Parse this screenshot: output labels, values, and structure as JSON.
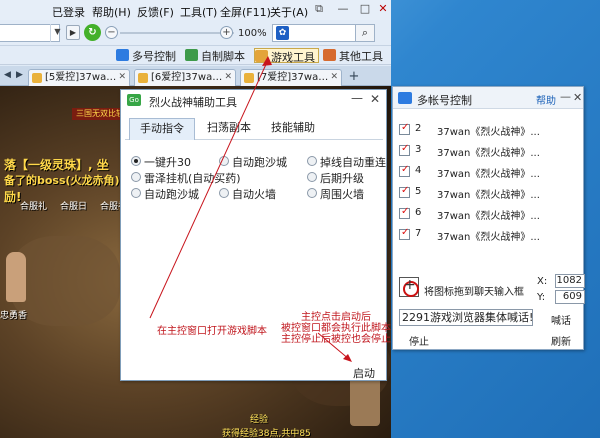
{
  "menu": {
    "login": "已登录",
    "help": "帮助(H)",
    "feedback": "反馈(F)",
    "tools": "工具(T)",
    "fullscreen": "全屏(F11)",
    "about": "关于(A)"
  },
  "toolbar": {
    "zoom": "100%"
  },
  "toolbar2": {
    "multi": "多号控制",
    "script": "自制脚本",
    "game_tools": "游戏工具",
    "other_tools": "其他工具"
  },
  "tabs": [
    {
      "label": "[5爱控]37wa…"
    },
    {
      "label": "[6爱控]37wa…"
    },
    {
      "label": "[7爱控]37wa…"
    }
  ],
  "game": {
    "line1": "落【一级灵珠】, 坐",
    "line2": "备了的boss(火龙赤角)",
    "line3": "励!",
    "banner": "三国无双比较",
    "npc1": "合服礼",
    "npc2": "合服日",
    "npc3": "合服礼",
    "bottom1": "经验",
    "bottom2": "获得经验38点,共中85",
    "left_text": "忠勇香"
  },
  "helper": {
    "title": "烈火战神辅助工具",
    "tabs": [
      "手动指令",
      "扫荡副本",
      "技能辅助"
    ],
    "options": [
      "一键升30",
      "自动跑沙城",
      "掉线自动重连",
      "雷泽挂机(自动买药)",
      "后期升级",
      "自动跑沙城",
      "自动火墙",
      "周围火墙"
    ],
    "note_center": "在主控窗口打开游戏脚本",
    "note_right1": "主控点击启动后",
    "note_right2": "被控窗口都会执行此脚本",
    "note_right3": "主控停止后被控也会停止",
    "start": "启动"
  },
  "multi": {
    "title": "多帐号控制",
    "help": "帮助",
    "accounts": [
      {
        "num": "2",
        "name": "37wan《烈火战神》..."
      },
      {
        "num": "3",
        "name": "37wan《烈火战神》..."
      },
      {
        "num": "4",
        "name": "37wan《烈火战神》..."
      },
      {
        "num": "5",
        "name": "37wan《烈火战神》..."
      },
      {
        "num": "6",
        "name": "37wan《烈火战神》..."
      },
      {
        "num": "7",
        "name": "37wan《烈火战神》..."
      }
    ],
    "drag_label": "将图标拖到聊天输入框",
    "x_label": "X:",
    "x_value": "1082",
    "y_label": "Y:",
    "y_value": "609",
    "input_value": "2291游戏浏览器集体喊话!",
    "stop": "停止",
    "shout": "喊话",
    "refresh": "刷新"
  }
}
